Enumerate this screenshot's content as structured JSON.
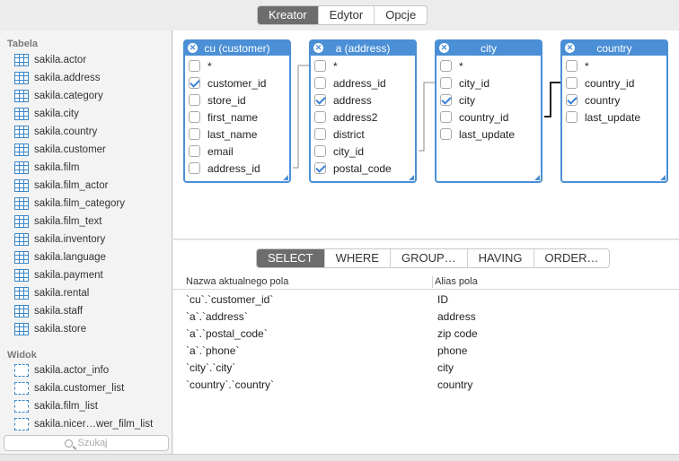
{
  "toolbar": {
    "tabs": [
      {
        "label": "Kreator",
        "active": true
      },
      {
        "label": "Edytor",
        "active": false
      },
      {
        "label": "Opcje",
        "active": false
      }
    ]
  },
  "sidebar": {
    "tables_header": "Tabela",
    "tables": [
      "sakila.actor",
      "sakila.address",
      "sakila.category",
      "sakila.city",
      "sakila.country",
      "sakila.customer",
      "sakila.film",
      "sakila.film_actor",
      "sakila.film_category",
      "sakila.film_text",
      "sakila.inventory",
      "sakila.language",
      "sakila.payment",
      "sakila.rental",
      "sakila.staff",
      "sakila.store"
    ],
    "views_header": "Widok",
    "views": [
      "sakila.actor_info",
      "sakila.customer_list",
      "sakila.film_list",
      "sakila.nicer…wer_film_list"
    ],
    "search_placeholder": "Szukaj"
  },
  "diagram": {
    "tables": [
      {
        "title": "cu (customer)",
        "fields": [
          {
            "name": "*",
            "checked": false
          },
          {
            "name": "customer_id",
            "checked": true
          },
          {
            "name": "store_id",
            "checked": false
          },
          {
            "name": "first_name",
            "checked": false
          },
          {
            "name": "last_name",
            "checked": false
          },
          {
            "name": "email",
            "checked": false
          },
          {
            "name": "address_id",
            "checked": false
          }
        ]
      },
      {
        "title": "a (address)",
        "fields": [
          {
            "name": "*",
            "checked": false
          },
          {
            "name": "address_id",
            "checked": false
          },
          {
            "name": "address",
            "checked": true
          },
          {
            "name": "address2",
            "checked": false
          },
          {
            "name": "district",
            "checked": false
          },
          {
            "name": "city_id",
            "checked": false
          },
          {
            "name": "postal_code",
            "checked": true
          }
        ]
      },
      {
        "title": "city",
        "fields": [
          {
            "name": "*",
            "checked": false
          },
          {
            "name": "city_id",
            "checked": false
          },
          {
            "name": "city",
            "checked": true
          },
          {
            "name": "country_id",
            "checked": false
          },
          {
            "name": "last_update",
            "checked": false
          }
        ]
      },
      {
        "title": "country",
        "fields": [
          {
            "name": "*",
            "checked": false
          },
          {
            "name": "country_id",
            "checked": false
          },
          {
            "name": "country",
            "checked": true
          },
          {
            "name": "last_update",
            "checked": false
          }
        ]
      }
    ]
  },
  "clauses": {
    "tabs": [
      {
        "label": "SELECT",
        "active": true
      },
      {
        "label": "WHERE",
        "active": false
      },
      {
        "label": "GROUP…",
        "active": false
      },
      {
        "label": "HAVING",
        "active": false
      },
      {
        "label": "ORDER…",
        "active": false
      }
    ]
  },
  "select_grid": {
    "col_field": "Nazwa aktualnego pola",
    "col_alias": "Alias pola",
    "rows": [
      {
        "field": "`cu`.`customer_id`",
        "alias": "ID"
      },
      {
        "field": "`a`.`address`",
        "alias": "address"
      },
      {
        "field": "`a`.`postal_code`",
        "alias": "zip code"
      },
      {
        "field": "`a`.`phone`",
        "alias": "phone"
      },
      {
        "field": "`city`.`city`",
        "alias": "city"
      },
      {
        "field": "`country`.`country`",
        "alias": "country"
      }
    ]
  },
  "colors": {
    "accent": "#4b8fd6",
    "active_tab": "#6d6d6d"
  }
}
